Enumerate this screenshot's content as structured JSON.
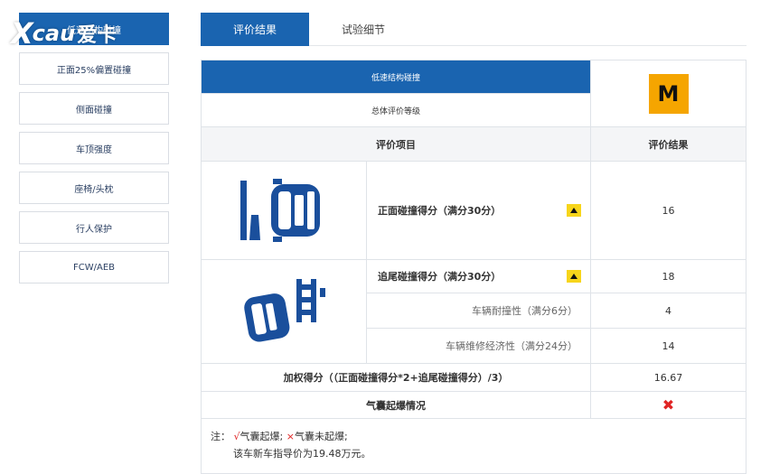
{
  "logo": {
    "x": "X",
    "cau": "cau",
    "cn": "爱卡"
  },
  "sidebar": {
    "items": [
      {
        "label": "低速结构碰撞"
      },
      {
        "label": "正面25%偏置碰撞"
      },
      {
        "label": "侧面碰撞"
      },
      {
        "label": "车顶强度"
      },
      {
        "label": "座椅/头枕"
      },
      {
        "label": "行人保护"
      },
      {
        "label": "FCW/AEB"
      }
    ]
  },
  "tabs": [
    {
      "label": "评价结果"
    },
    {
      "label": "试验细节"
    }
  ],
  "table": {
    "section_title": "低速结构碰撞",
    "overall_label": "总体评价等级",
    "overall_grade": "M",
    "col_item": "评价项目",
    "col_result": "评价结果",
    "front_label": "正面碰撞得分（满分30分）",
    "front_score": "16",
    "rear_label": "追尾碰撞得分（满分30分）",
    "rear_score": "18",
    "durability_label": "车辆耐撞性（满分6分）",
    "durability_score": "4",
    "repair_label": "车辆维修经济性（满分24分）",
    "repair_score": "14",
    "weighted_label": "加权得分（（正面碰撞得分*2+追尾碰撞得分）/3）",
    "weighted_score": "16.67",
    "airbag_label": "气囊起爆情况",
    "airbag_result": "✖"
  },
  "note": {
    "prefix": "注：",
    "check": "√",
    "deployed": "气囊起爆;",
    "cross": "×",
    "not_deployed": "气囊未起爆;",
    "price": "该车新车指导价为19.48万元。"
  },
  "colors": {
    "brand_blue": "#1a64b0",
    "grade_orange": "#f5a500",
    "arrow_yellow": "#f7d51b",
    "red": "#e02424"
  }
}
